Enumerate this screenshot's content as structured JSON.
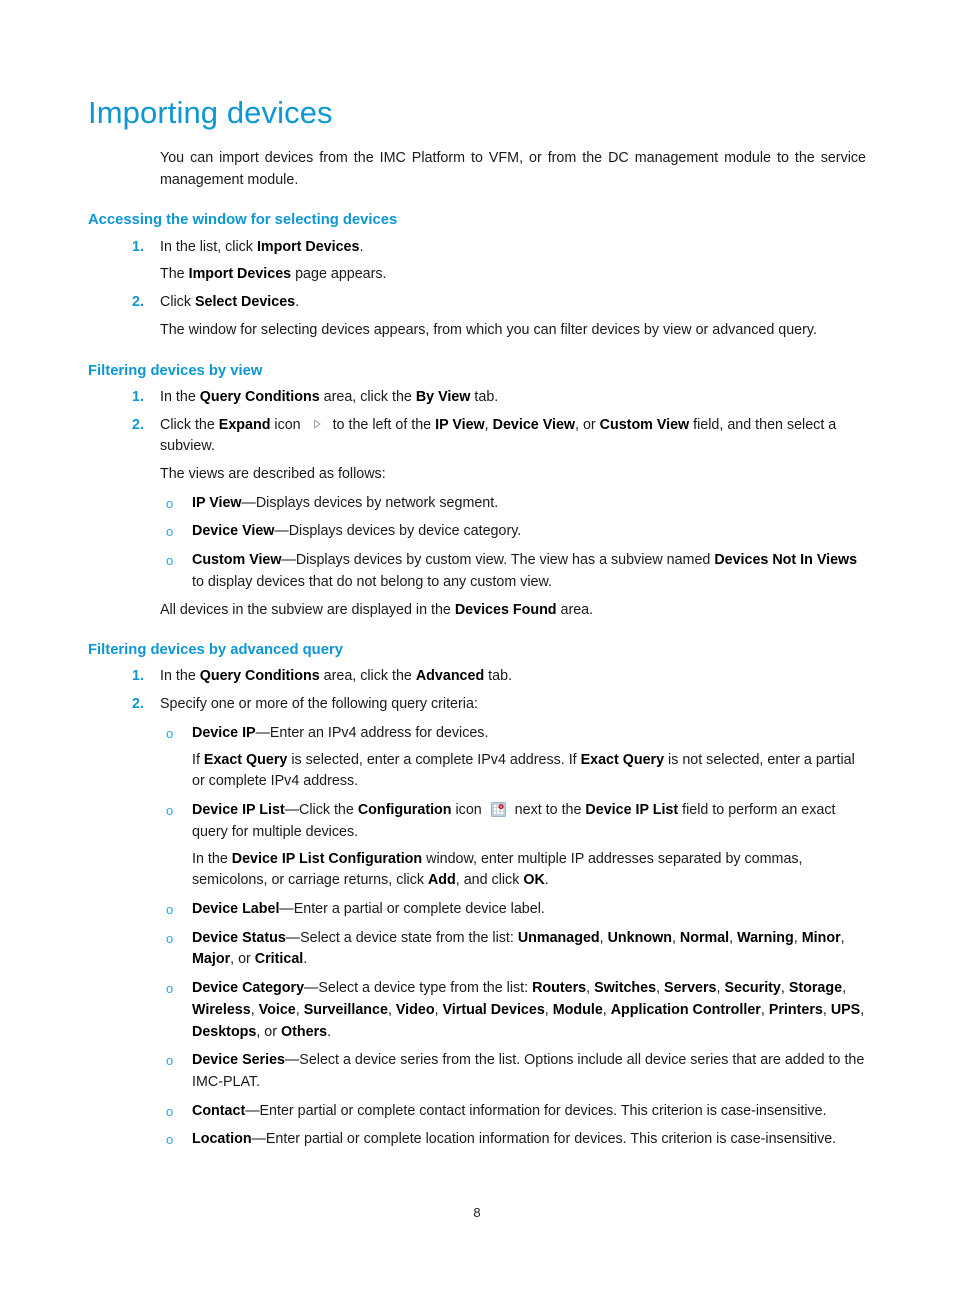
{
  "document": {
    "title": "Importing devices",
    "page_number": "8"
  },
  "intro": {
    "text": "You can import devices from the IMC Platform to VFM, or from the DC management module to the service management module."
  },
  "sections": [
    {
      "heading": "Accessing the window for selecting devices",
      "steps": [
        {
          "num": "1.",
          "html": "In the list, click <b>Import Devices</b>."
        },
        {
          "num": "",
          "html": "The <b>Import Devices</b> page appears.",
          "kind": "cont"
        },
        {
          "num": "2.",
          "html": "Click <b>Select Devices</b>."
        },
        {
          "num": "",
          "html": "The window for selecting devices appears, from which you can filter devices by view or advanced query.",
          "kind": "cont"
        }
      ]
    },
    {
      "heading": "Filtering devices by view",
      "steps": [
        {
          "num": "1.",
          "html": "In the <b>Query Conditions</b> area, click the <b>By View</b> tab."
        },
        {
          "num": "2.",
          "html": "Click the <b>Expand</b> icon &nbsp;to the left of the <b>IP View</b>, <b>Device View</b>, or <b>Custom View</b> field, and then select a subview."
        },
        {
          "num": "",
          "html": "The views are described as follows:",
          "kind": "cont"
        }
      ],
      "bullets": [
        {
          "mark": "o",
          "html": "<b>IP View</b>&#8212;Displays devices by network segment."
        },
        {
          "mark": "o",
          "html": "<b>Device View</b>&#8212;Displays devices by device category."
        },
        {
          "mark": "o",
          "html": "<b>Custom View</b>&#8212;Displays devices by custom view. The view has a subview named <b>Devices Not In Views</b> to display devices that do not belong to any custom view."
        }
      ],
      "closing": "All devices in the subview are displayed in the <b>Devices Found</b> area."
    },
    {
      "heading": "Filtering devices by advanced query",
      "steps": [
        {
          "num": "1.",
          "html": "In the <b>Query Conditions</b> area, click the <b>Advanced</b> tab."
        },
        {
          "num": "2.",
          "html": "Specify one or more of the following query criteria:"
        }
      ],
      "bullets": [
        {
          "mark": "o",
          "html": "<b>Device IP</b>&#8212;Enter an IPv4 address for devices."
        },
        {
          "mark": "",
          "kind": "cont",
          "html": "If <b>Exact Query</b> is selected, enter a complete IPv4 address. If <b>Exact Query</b> is not selected, enter a partial or complete IPv4 address."
        },
        {
          "mark": "o",
          "html": "<b>Device IP List</b>&#8212;Click the <b>Configuration</b> icon &nbsp;next to the <b>Device IP List</b> field to perform an exact query for multiple devices."
        },
        {
          "mark": "",
          "kind": "cont",
          "html": "In the <b>Device IP List Configuration</b> window, enter multiple IP addresses separated by commas, semicolons, or carriage returns, click <b>Add</b>, and click <b>OK</b>."
        },
        {
          "mark": "o",
          "html": "<b>Device Label</b>&#8212;Enter a partial or complete device label."
        },
        {
          "mark": "o",
          "html": "<b>Device Status</b>&#8212;Select a device state from the list: <b>Unmanaged</b>, <b>Unknown</b>, <b>Normal</b>, <b>Warning</b>, <b>Minor</b>, <b>Major</b>, or <b>Critical</b>."
        },
        {
          "mark": "o",
          "html": "<b>Device Category</b>&#8212;Select a device type from the list: <b>Routers</b>, <b>Switches</b>, <b>Servers</b>, <b>Security</b>, <b>Storage</b>, <b>Wireless</b>, <b>Voice</b>, <b>Surveillance</b>, <b>Video</b>, <b>Virtual Devices</b>, <b>Module</b>, <b>Application Controller</b>, <b>Printers</b>, <b>UPS</b>, <b>Desktops</b>, or <b>Others</b>."
        },
        {
          "mark": "o",
          "html": "<b>Device Series</b>&#8212;Select a device series from the list. Options include all device series that are added to the IMC-PLAT."
        },
        {
          "mark": "o",
          "html": "<b>Contact</b>&#8212;Enter partial or complete contact information for devices. This criterion is case-insensitive."
        },
        {
          "mark": "o",
          "html": "<b>Location</b>&#8212;Enter partial or complete location information for devices. This criterion is case-insensitive."
        }
      ]
    }
  ],
  "icons": {
    "expand": "expand-triangle-icon",
    "configuration": "configuration-grid-icon"
  },
  "colors": {
    "title_blue": "#0d97d4",
    "heading_blue": "#0d97d4",
    "bullet_blue": "#2ba6dd",
    "body_text": "#1a1a1a"
  }
}
